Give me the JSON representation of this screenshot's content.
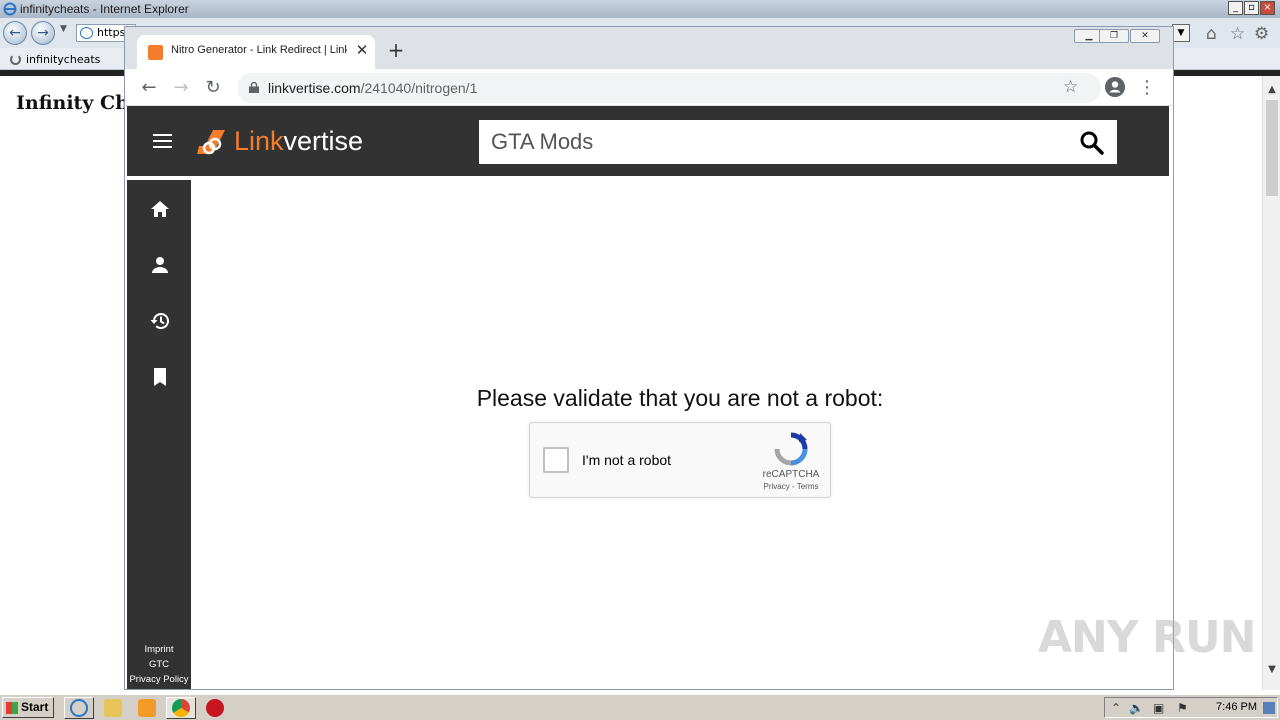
{
  "ie": {
    "window_title": "infinitycheats - Internet Explorer",
    "address_text": "https",
    "tab_label": "infinitycheats",
    "page_heading": "Infinity Ch"
  },
  "chrome": {
    "tab_title": "Nitro Generator - Link Redirect | Linkvertise",
    "url_domain": "linkvertise.com",
    "url_path": "/241040/nitrogen/1"
  },
  "linkvertise": {
    "logo_link": "Link",
    "logo_vertise": "vertise",
    "search_value": "GTA Mods",
    "sidebar_items": [
      "home",
      "profile",
      "history",
      "bookmarks"
    ],
    "footer_links": [
      "Imprint",
      "GTC",
      "Privacy Policy"
    ],
    "validate_heading": "Please validate that you are not a robot:",
    "brand_color": "#f47c2b",
    "header_bg": "#323232"
  },
  "recaptcha": {
    "label": "I'm not a robot",
    "brand": "reCAPTCHA",
    "links": "Privacy - Terms"
  },
  "watermark": "ANY RUN",
  "taskbar": {
    "start_label": "Start",
    "clock": "7:46 PM"
  }
}
